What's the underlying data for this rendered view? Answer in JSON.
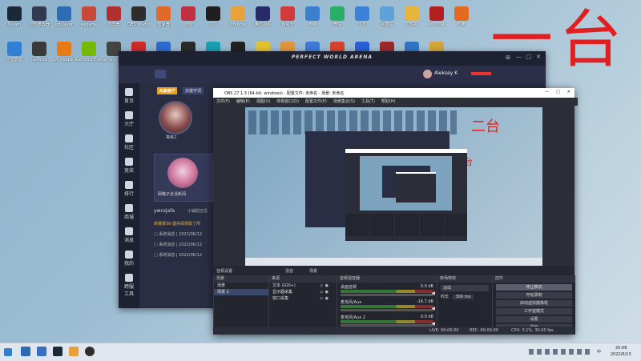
{
  "desktop": {
    "row1": [
      {
        "label": "Steam",
        "color": "#1b2838"
      },
      {
        "label": "OBS修改器",
        "color": "#333a4d"
      },
      {
        "label": "qdplayer",
        "color": "#2e6db4"
      },
      {
        "label": "wegame",
        "color": "#c8483a"
      },
      {
        "label": "浏览器",
        "color": "#b03030"
      },
      {
        "label": "OBS Studio",
        "color": "#2d2d2d"
      },
      {
        "label": "加速器",
        "color": "#e06a2a"
      },
      {
        "label": "游戏",
        "color": "#c03040"
      },
      {
        "label": "QQ",
        "color": "#1f1f1f"
      },
      {
        "label": "Chrome",
        "color": "#e9a23b"
      },
      {
        "label": "腾讯视频",
        "color": "#2a2a6a"
      },
      {
        "label": "网易云",
        "color": "#d33a3a"
      },
      {
        "label": "电脑",
        "color": "#3a7fd0"
      },
      {
        "label": "微信",
        "color": "#2aae67"
      },
      {
        "label": "消息",
        "color": "#3b82d6"
      },
      {
        "label": "回收站",
        "color": "#5ea2d9"
      },
      {
        "label": "文件夹",
        "color": "#e7b53c"
      },
      {
        "label": "网游加速",
        "color": "#b42020"
      },
      {
        "label": "应用",
        "color": "#e36a1f"
      }
    ],
    "row2": [
      {
        "label": "迅雷影音",
        "color": "#2f7fd4"
      },
      {
        "label": "GeForce",
        "color": "#3a3a3a"
      },
      {
        "label": "VLC media player",
        "color": "#e57a17"
      },
      {
        "label": "GeForce Experience",
        "color": "#76b900"
      },
      {
        "label": "GeForce Experience",
        "color": "#444"
      },
      {
        "label": "",
        "color": "#d02a2a"
      },
      {
        "label": "",
        "color": "#2d6bd1"
      },
      {
        "label": "",
        "color": "#2b2b2b"
      },
      {
        "label": "",
        "color": "#18a0b3"
      },
      {
        "label": "G",
        "color": "#222"
      },
      {
        "label": "",
        "color": "#e3c22d"
      },
      {
        "label": "",
        "color": "#e3953a"
      },
      {
        "label": "",
        "color": "#3d7ad8"
      },
      {
        "label": "",
        "color": "#d6432d"
      },
      {
        "label": "",
        "color": "#2a5fd6"
      },
      {
        "label": "",
        "color": "#9c2a2a"
      },
      {
        "label": "",
        "color": "#3176c4"
      },
      {
        "label": "",
        "color": "#d3a53a"
      }
    ]
  },
  "annotations": {
    "big": "一台",
    "mid": "二台",
    "small": "三台"
  },
  "pwa": {
    "title": "PERFECT WORLD ARENA",
    "user": "Aleksey K",
    "sidebar": [
      "首页",
      "大厅",
      "社区",
      "竞技",
      "排行",
      "商城",
      "消息",
      "我的",
      "跨服工具"
    ],
    "profile_tag": "A级用户",
    "tag2": "关键字词",
    "user_level": "等级2",
    "handle": "ywcsjafa",
    "status_text": "小辅助还没",
    "friend_label": "网格子全活新闻",
    "news_title": "新赛季06-建兵阀领取了所",
    "news_items": [
      "系统消息 | 2022/06/12",
      "系统消息 | 2022/06/12",
      "系统消息 | 2022/06/12"
    ]
  },
  "obs": {
    "title": "OBS 27.1.3 (64-bit, windows) - 配置文件: 未命名 - 场景: 未命名",
    "menu": [
      "文件(F)",
      "编辑(E)",
      "视图(V)",
      "停靠窗口(D)",
      "配置文件(P)",
      "场景集合(S)",
      "工具(T)",
      "帮助(H)"
    ],
    "tabs": [
      "音频设置",
      "混音",
      "场景"
    ],
    "docks": {
      "scenes_title": "场景",
      "scenes": [
        "场景",
        "场景 2"
      ],
      "sources_title": "来源",
      "sources": [
        "文本 (GDI+)",
        "显示器采集",
        "窗口采集"
      ],
      "mixer_title": "音频混音器",
      "mixer": [
        {
          "name": "桌面音频",
          "db": "0.0 dB"
        },
        {
          "name": "麦克风/Aux",
          "db": "-16.7 dB"
        },
        {
          "name": "麦克风/Aux 2",
          "db": "0.0 dB"
        }
      ],
      "transitions_title": "转场特效",
      "transition_type": "淡出",
      "duration_label": "时长",
      "duration": "300 ms",
      "controls_title": "控件",
      "controls": [
        "停止推流",
        "开始录制",
        "启动虚拟摄像机",
        "工作室模式",
        "设置",
        "退出"
      ]
    },
    "status": {
      "live": "LIVE: 00:00:00",
      "rec": "REC: 00:00:00",
      "cpu": "CPU: 3.1%, 30.00 fps"
    }
  },
  "taskbar": {
    "time": "20:08",
    "date": "2022/6/13",
    "lang": "中"
  }
}
